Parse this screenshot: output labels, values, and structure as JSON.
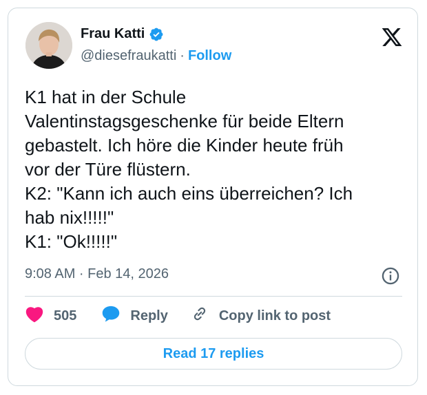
{
  "author": {
    "name": "Frau Katti",
    "handle": "@diesefraukatti",
    "separator": "·",
    "follow_label": "Follow"
  },
  "post": {
    "text": "K1 hat in der Schule\nValentinstagsgeschenke für beide Eltern\ngebastelt. Ich höre die Kinder heute früh\nvor der Türe flüstern.\nK2: \"Kann ich auch eins überreichen? Ich\nhab nix!!!!!\"\nK1: \"Ok!!!!!\"",
    "timestamp": "9:08 AM · Feb 14, 2026"
  },
  "actions": {
    "like_count": "505",
    "reply_label": "Reply",
    "copy_link_label": "Copy link to post"
  },
  "read_replies_label": "Read 17 replies",
  "colors": {
    "accent": "#1d9bf0",
    "like": "#f91880",
    "text": "#0f1419",
    "muted": "#536471",
    "border": "#cfd9de"
  },
  "icons": [
    "verified-badge-icon",
    "x-logo-icon",
    "info-icon",
    "heart-icon",
    "reply-bubble-icon",
    "link-icon"
  ]
}
